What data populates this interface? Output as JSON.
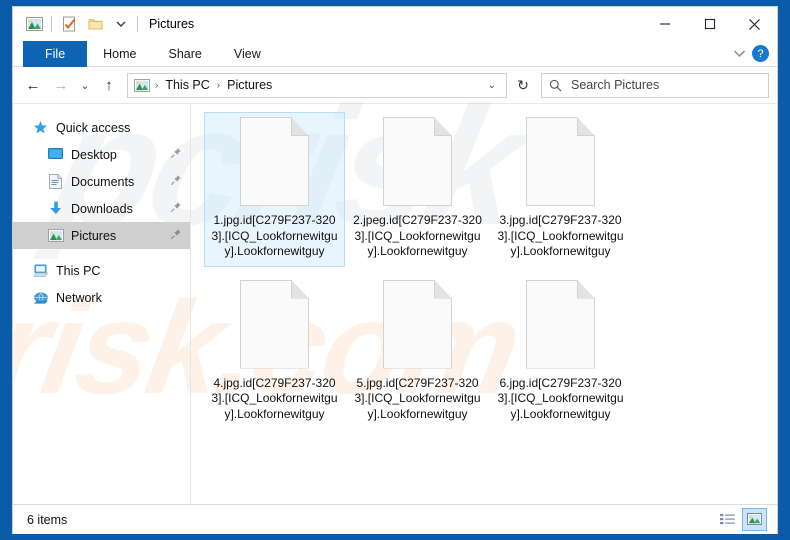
{
  "window": {
    "title": "Pictures",
    "quick_access_icons": [
      "pictures-icon",
      "properties-icon",
      "new-folder-icon",
      "customize-chevron-icon"
    ],
    "controls": {
      "minimize": "—",
      "maximize": "☐",
      "close": "✕"
    }
  },
  "ribbon": {
    "tabs": [
      {
        "label": "File",
        "active": true
      },
      {
        "label": "Home",
        "active": false
      },
      {
        "label": "Share",
        "active": false
      },
      {
        "label": "View",
        "active": false
      }
    ],
    "expand_icon": "chevron-down-icon",
    "help_label": "?"
  },
  "address": {
    "back_icon": "←",
    "forward_icon": "→",
    "recent_icon": "⌄",
    "up_icon": "↑",
    "crumbs": [
      "This PC",
      "Pictures"
    ],
    "crumb_sep": "›",
    "dropdown_icon": "⌄",
    "refresh_icon": "↻",
    "search_placeholder": "Search Pictures"
  },
  "sidebar": {
    "items": [
      {
        "label": "Quick access",
        "icon": "star-icon",
        "indent": false,
        "pinned": false,
        "selected": false
      },
      {
        "label": "Desktop",
        "icon": "desktop-icon",
        "indent": true,
        "pinned": true,
        "selected": false
      },
      {
        "label": "Documents",
        "icon": "documents-icon",
        "indent": true,
        "pinned": true,
        "selected": false
      },
      {
        "label": "Downloads",
        "icon": "downloads-icon",
        "indent": true,
        "pinned": true,
        "selected": false
      },
      {
        "label": "Pictures",
        "icon": "pictures-icon",
        "indent": true,
        "pinned": true,
        "selected": true
      },
      {
        "label": "This PC",
        "icon": "this-pc-icon",
        "indent": false,
        "pinned": false,
        "selected": false
      },
      {
        "label": "Network",
        "icon": "network-icon",
        "indent": false,
        "pinned": false,
        "selected": false
      }
    ]
  },
  "files": [
    {
      "name": "1.jpg.id[C279F237-3203].[ICQ_Lookfornewitguy].Lookfornewitguy",
      "icon": "blank-file-icon",
      "selected": true
    },
    {
      "name": "2.jpeg.id[C279F237-3203].[ICQ_Lookfornewitguy].Lookfornewitguy",
      "icon": "blank-file-icon",
      "selected": false
    },
    {
      "name": "3.jpg.id[C279F237-3203].[ICQ_Lookfornewitguy].Lookfornewitguy",
      "icon": "blank-file-icon",
      "selected": false
    },
    {
      "name": "4.jpg.id[C279F237-3203].[ICQ_Lookfornewitguy].Lookfornewitguy",
      "icon": "blank-file-icon",
      "selected": false
    },
    {
      "name": "5.jpg.id[C279F237-3203].[ICQ_Lookfornewitguy].Lookfornewitguy",
      "icon": "blank-file-icon",
      "selected": false
    },
    {
      "name": "6.jpg.id[C279F237-3203].[ICQ_Lookfornewitguy].Lookfornewitguy",
      "icon": "blank-file-icon",
      "selected": false
    }
  ],
  "status": {
    "item_count": "6 items",
    "views": [
      {
        "name": "details-view",
        "active": false
      },
      {
        "name": "large-icons-view",
        "active": true
      }
    ]
  },
  "watermark": {
    "top": "pcrisk",
    "bottom": "risk.com"
  },
  "colors": {
    "desktop": "#0a5ca8",
    "accent": "#0e64b4",
    "selection": "#cde8ff",
    "sidebar_selected": "#cfcfcf",
    "help": "#1878d4"
  }
}
